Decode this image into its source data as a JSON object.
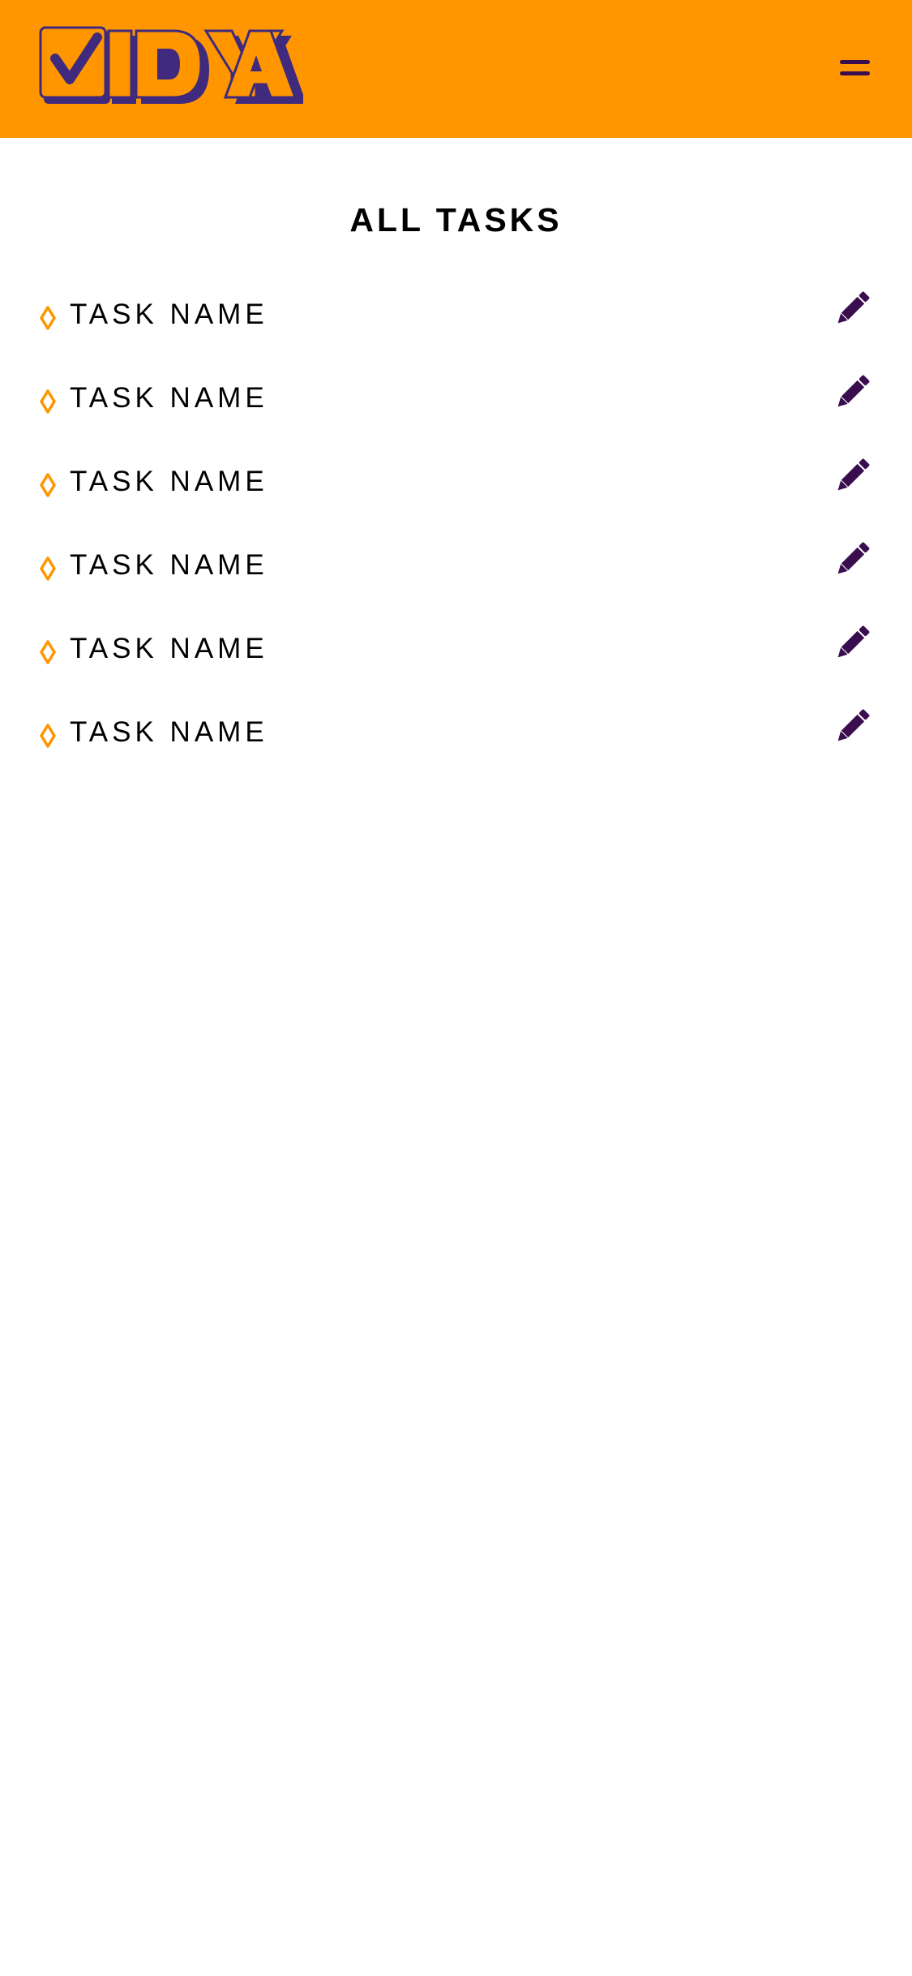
{
  "app": {
    "brand_name": "VIDYA",
    "colors": {
      "header_background": "#ff9600",
      "brand_purple": "#3f2a7d",
      "icon_purple": "#3a0d4f",
      "bullet_orange": "#ff9600"
    }
  },
  "header": {
    "logo_icon": "vidya-logo-checkbox",
    "menu_icon": "hamburger-menu-icon"
  },
  "main": {
    "title": "ALL TASKS",
    "tasks": [
      {
        "name": "TASK NAME",
        "bullet_icon": "diamond-outline-icon",
        "action_icon": "pencil-icon"
      },
      {
        "name": "TASK NAME",
        "bullet_icon": "diamond-outline-icon",
        "action_icon": "pencil-icon"
      },
      {
        "name": "TASK NAME",
        "bullet_icon": "diamond-outline-icon",
        "action_icon": "pencil-icon"
      },
      {
        "name": "TASK NAME",
        "bullet_icon": "diamond-outline-icon",
        "action_icon": "pencil-icon"
      },
      {
        "name": "TASK NAME",
        "bullet_icon": "diamond-outline-icon",
        "action_icon": "pencil-icon"
      },
      {
        "name": "TASK NAME",
        "bullet_icon": "diamond-outline-icon",
        "action_icon": "pencil-icon"
      }
    ]
  }
}
